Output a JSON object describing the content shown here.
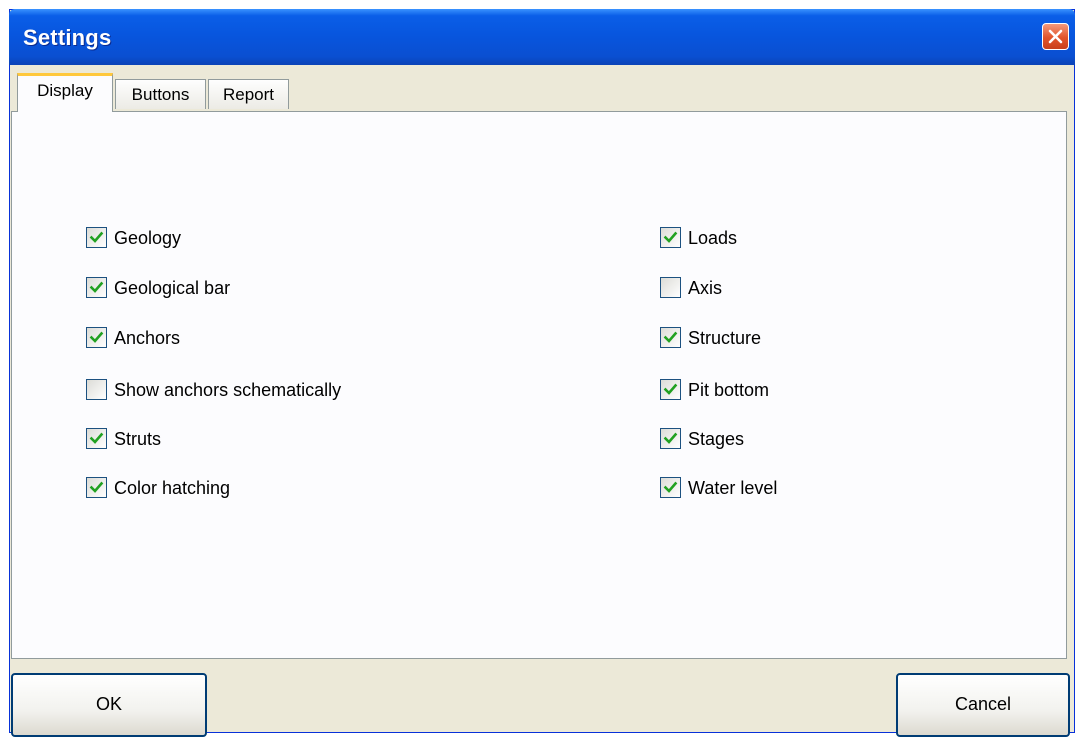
{
  "window": {
    "title": "Settings"
  },
  "tabs": [
    {
      "label": "Display",
      "active": true
    },
    {
      "label": "Buttons",
      "active": false
    },
    {
      "label": "Report",
      "active": false
    }
  ],
  "display": {
    "left_column": [
      {
        "label": "Geology",
        "checked": true
      },
      {
        "label": "Geological bar",
        "checked": true
      },
      {
        "label": "Anchors",
        "checked": true
      },
      {
        "label": "Show anchors schematically",
        "checked": false
      },
      {
        "label": "Struts",
        "checked": true
      },
      {
        "label": "Color hatching",
        "checked": true
      }
    ],
    "right_column": [
      {
        "label": "Loads",
        "checked": true
      },
      {
        "label": "Axis",
        "checked": false
      },
      {
        "label": "Structure",
        "checked": true
      },
      {
        "label": "Pit bottom",
        "checked": true
      },
      {
        "label": "Stages",
        "checked": true
      },
      {
        "label": "Water level",
        "checked": true
      }
    ]
  },
  "buttons": {
    "ok": "OK",
    "cancel": "Cancel"
  },
  "colors": {
    "titlebar": "#0855dd",
    "active_tab_accent": "#ffc83c",
    "checkmark": "#21a121",
    "close_button": "#e2542a"
  }
}
